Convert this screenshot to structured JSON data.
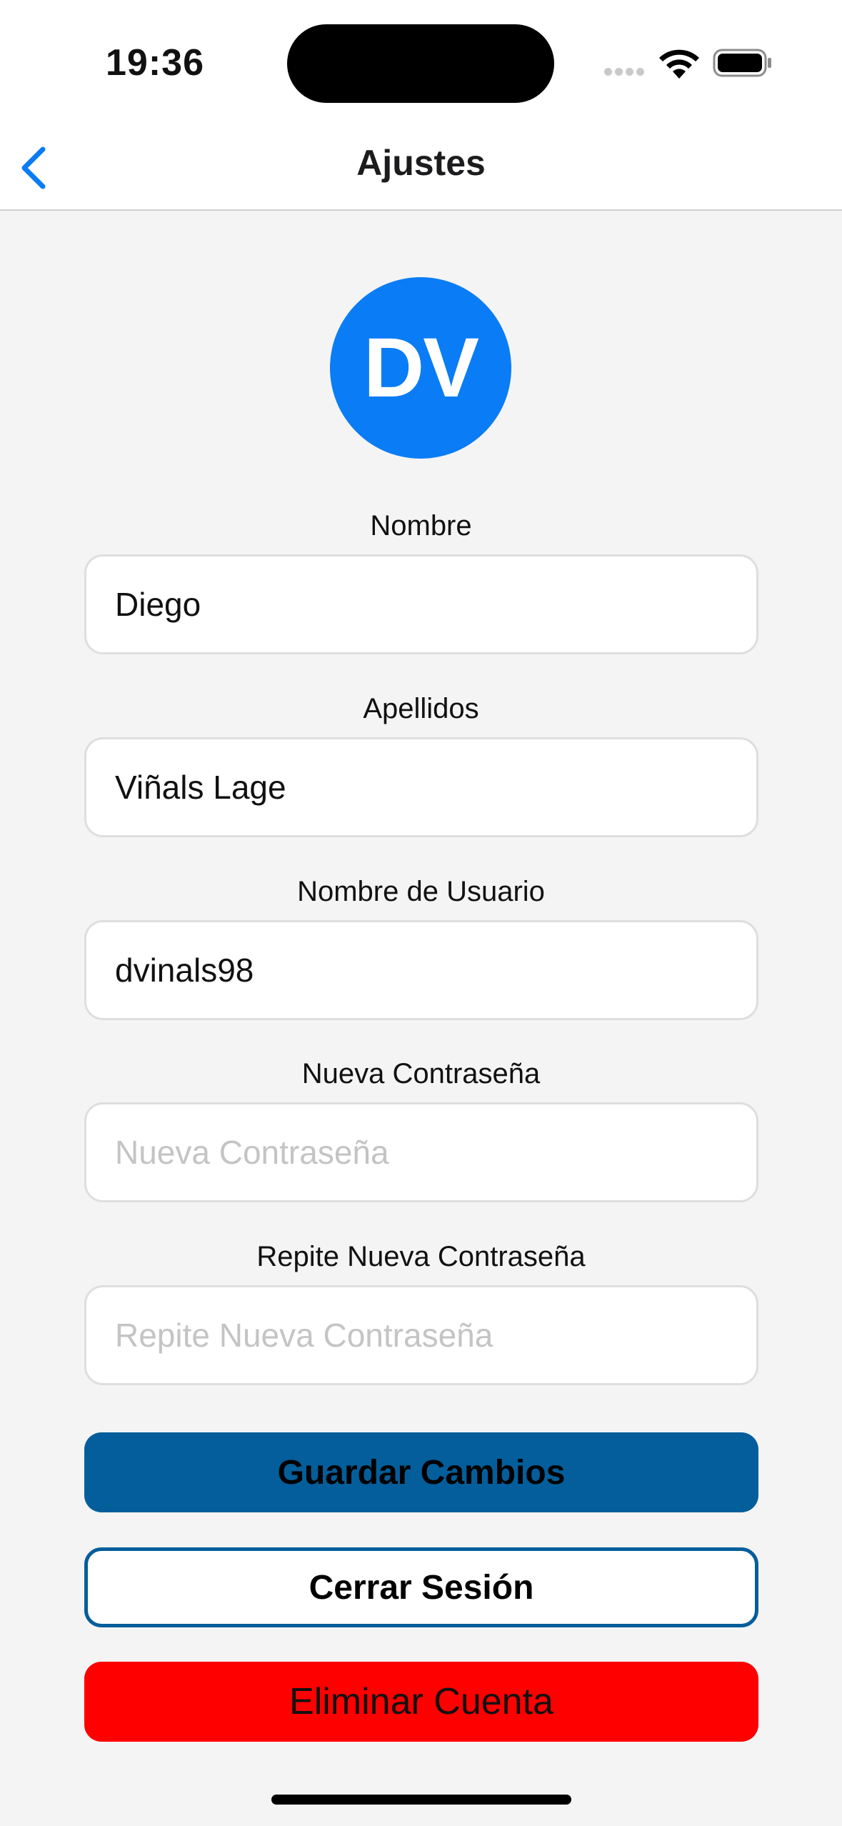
{
  "status_bar": {
    "time": "19:36"
  },
  "nav": {
    "title": "Ajustes",
    "back_icon": "chevron-left-icon"
  },
  "avatar": {
    "initials": "DV",
    "color": "#0a7cf5"
  },
  "form": {
    "nombre": {
      "label": "Nombre",
      "value": "Diego",
      "placeholder": ""
    },
    "apellidos": {
      "label": "Apellidos",
      "value": "Viñals Lage",
      "placeholder": ""
    },
    "usuario": {
      "label": "Nombre de Usuario",
      "value": "dvinals98",
      "placeholder": ""
    },
    "nueva_contrasena": {
      "label": "Nueva Contraseña",
      "value": "",
      "placeholder": "Nueva Contraseña"
    },
    "repite_contrasena": {
      "label": "Repite Nueva Contraseña",
      "value": "",
      "placeholder": "Repite Nueva Contraseña"
    }
  },
  "buttons": {
    "save": "Guardar Cambios",
    "logout": "Cerrar Sesión",
    "delete": "Eliminar Cuenta"
  },
  "colors": {
    "accent": "#0a7cf5",
    "primary_button": "#035e9b",
    "danger_button": "#ff0000"
  }
}
